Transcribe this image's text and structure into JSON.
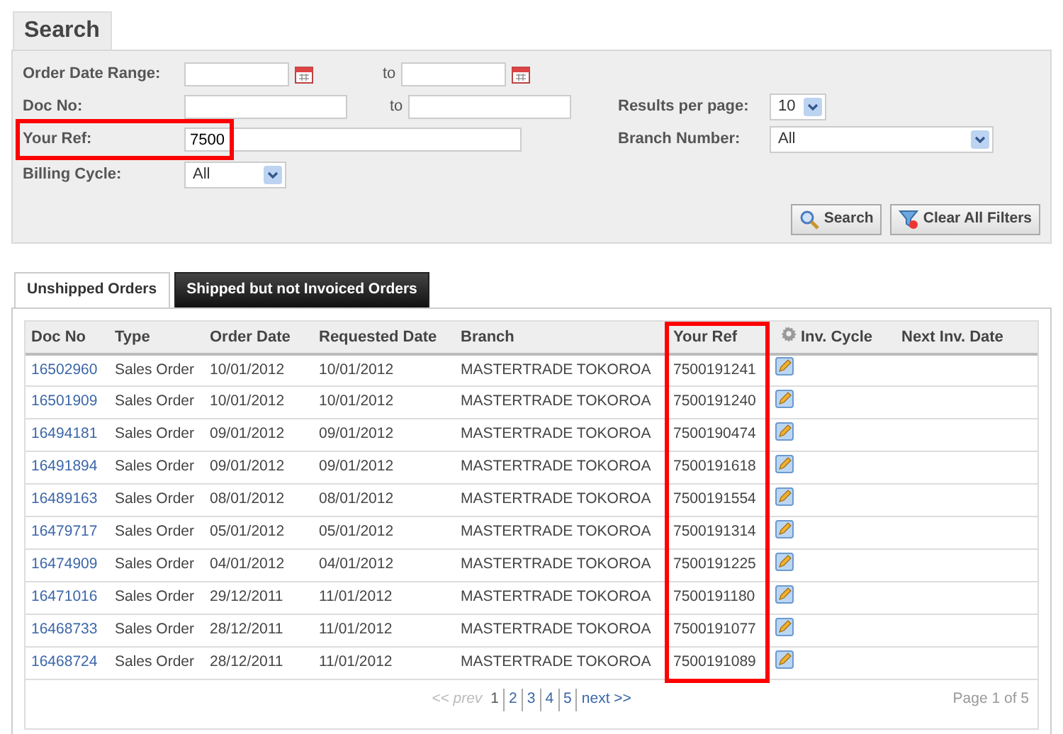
{
  "search_tab": {
    "label": "Search"
  },
  "filters": {
    "order_date_range": {
      "label": "Order Date Range:",
      "to_label": "to"
    },
    "doc_no": {
      "label": "Doc No:",
      "to_label": "to"
    },
    "your_ref": {
      "label": "Your Ref:",
      "value": "7500",
      "highlighted": true
    },
    "billing_cycle": {
      "label": "Billing Cycle:",
      "value": "All"
    },
    "results_per_page": {
      "label": "Results per page:",
      "value": "10"
    },
    "branch_number": {
      "label": "Branch Number:",
      "value": "All"
    }
  },
  "buttons": [
    {
      "label": "Search",
      "kind": "search"
    },
    {
      "label": "Clear All Filters",
      "kind": "clear"
    }
  ],
  "tabs": [
    {
      "label": "Unshipped Orders",
      "selected": true
    },
    {
      "label": "Shipped but not Invoiced Orders",
      "selected": false
    }
  ],
  "table": {
    "columns": [
      {
        "label": "Doc No"
      },
      {
        "label": "Type"
      },
      {
        "label": "Order Date"
      },
      {
        "label": "Requested Date"
      },
      {
        "label": "Branch"
      },
      {
        "label": "Your Ref",
        "highlighted": true
      },
      {
        "kind": "settings"
      },
      {
        "label": "Inv. Cycle"
      },
      {
        "label": "Next Inv. Date"
      }
    ],
    "rows": [
      [
        "16502960",
        "Sales Order",
        "10/01/2012",
        "10/01/2012",
        "MASTERTRADE TOKOROA",
        "7500191241"
      ],
      [
        "16501909",
        "Sales Order",
        "10/01/2012",
        "10/01/2012",
        "MASTERTRADE TOKOROA",
        "7500191240"
      ],
      [
        "16494181",
        "Sales Order",
        "09/01/2012",
        "09/01/2012",
        "MASTERTRADE TOKOROA",
        "7500190474"
      ],
      [
        "16491894",
        "Sales Order",
        "09/01/2012",
        "09/01/2012",
        "MASTERTRADE TOKOROA",
        "7500191618"
      ],
      [
        "16489163",
        "Sales Order",
        "08/01/2012",
        "08/01/2012",
        "MASTERTRADE TOKOROA",
        "7500191554"
      ],
      [
        "16479717",
        "Sales Order",
        "05/01/2012",
        "05/01/2012",
        "MASTERTRADE TOKOROA",
        "7500191314"
      ],
      [
        "16474909",
        "Sales Order",
        "04/01/2012",
        "04/01/2012",
        "MASTERTRADE TOKOROA",
        "7500191225"
      ],
      [
        "16471016",
        "Sales Order",
        "29/12/2011",
        "11/01/2012",
        "MASTERTRADE TOKOROA",
        "7500191180"
      ],
      [
        "16468733",
        "Sales Order",
        "28/12/2011",
        "11/01/2012",
        "MASTERTRADE TOKOROA",
        "7500191077"
      ],
      [
        "16468724",
        "Sales Order",
        "28/12/2011",
        "11/01/2012",
        "MASTERTRADE TOKOROA",
        "7500191089"
      ]
    ]
  },
  "pagination": {
    "prev": {
      "label": "<< prev",
      "disabled": true
    },
    "pages": [
      {
        "label": "1",
        "selected": true
      },
      {
        "label": "2",
        "selected": false
      },
      {
        "label": "3",
        "selected": false
      },
      {
        "label": "4",
        "selected": false
      },
      {
        "label": "5",
        "selected": false
      }
    ],
    "next": {
      "label": "next >>",
      "disabled": false
    },
    "summary": "Page 1 of 5"
  }
}
